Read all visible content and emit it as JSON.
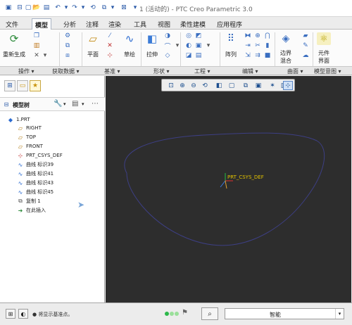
{
  "window": {
    "title": "1 (活动的) - PTC Creo Parametric 3.0"
  },
  "menu_tabs": [
    {
      "label": "文件"
    },
    {
      "label": "模型"
    },
    {
      "label": "分析"
    },
    {
      "label": "注释"
    },
    {
      "label": "渲染"
    },
    {
      "label": "工具"
    },
    {
      "label": "视图"
    },
    {
      "label": "柔性建模"
    },
    {
      "label": "应用程序"
    }
  ],
  "ribbon": {
    "regenerate": "重新生成",
    "plane": "平面",
    "sketch": "草绘",
    "extrude": "拉伸",
    "pattern": "阵列",
    "boundary_blend_line1": "边界",
    "boundary_blend_line2": "混合",
    "component_interface_line1": "元件",
    "component_interface_line2": "界面"
  },
  "ribbon_groups": {
    "operations": "操作",
    "get_data": "获取数据",
    "datum": "基准",
    "shapes": "形状",
    "engineering": "工程",
    "editing": "编辑",
    "surfaces": "曲面",
    "model_intent": "模型意图"
  },
  "model_tree": {
    "title": "模型树",
    "items": [
      {
        "label": "1.PRT"
      },
      {
        "label": "RIGHT"
      },
      {
        "label": "TOP"
      },
      {
        "label": "FRONT"
      },
      {
        "label": "PRT_CSYS_DEF"
      },
      {
        "label": "曲线 标识39"
      },
      {
        "label": "曲线 标识41"
      },
      {
        "label": "曲线 标识43"
      },
      {
        "label": "曲线 标识45"
      },
      {
        "label": "复制 1"
      },
      {
        "label": "在此插入"
      }
    ]
  },
  "viewport": {
    "csys_label": "PRT_CSYS_DEF"
  },
  "statusbar": {
    "message": "● 将显示基准点。",
    "filter": "智能"
  },
  "colors": {
    "viewport_bg": "#2d2d2d",
    "curve": "#3d3f84"
  }
}
